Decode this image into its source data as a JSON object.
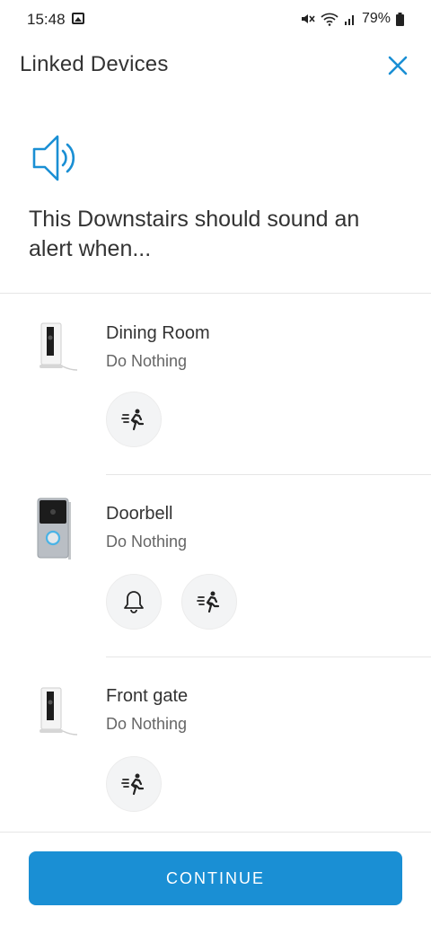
{
  "status_bar": {
    "time": "15:48",
    "battery": "79%"
  },
  "header": {
    "title": "Linked Devices"
  },
  "prompt": "This Downstairs should sound an alert when...",
  "devices": [
    {
      "name": "Dining Room",
      "status": "Do Nothing",
      "triggers": [
        "motion"
      ]
    },
    {
      "name": "Doorbell",
      "status": "Do Nothing",
      "triggers": [
        "ring",
        "motion"
      ]
    },
    {
      "name": "Front gate",
      "status": "Do Nothing",
      "triggers": [
        "motion"
      ]
    }
  ],
  "footer": {
    "continue_label": "CONTINUE"
  },
  "colors": {
    "accent": "#1a8fd4",
    "button_bg": "#1a8fd4",
    "trigger_bg": "#f3f4f5"
  }
}
